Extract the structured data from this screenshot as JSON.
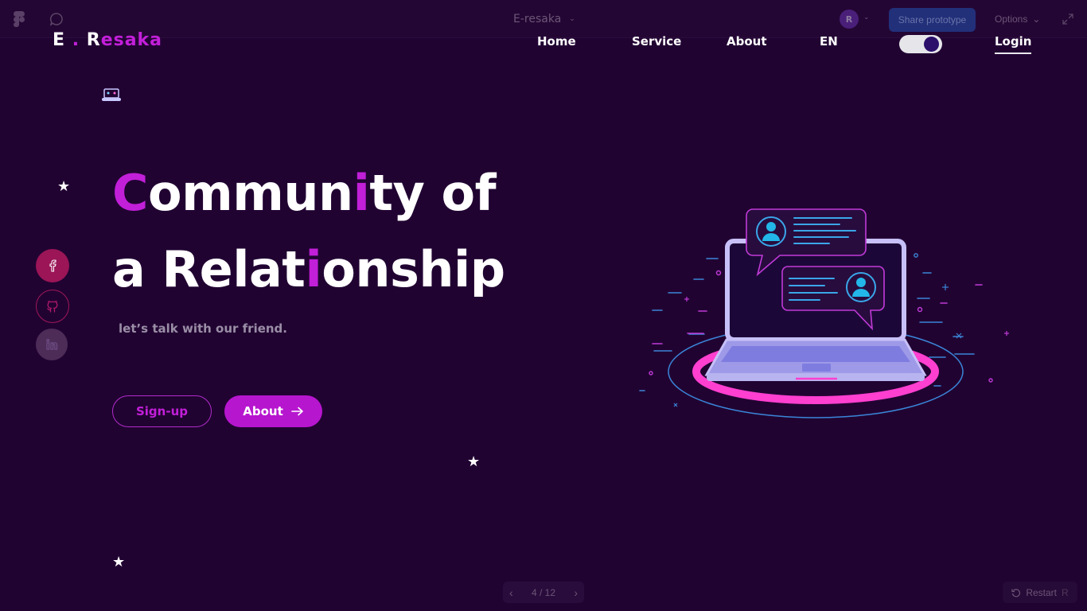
{
  "figma": {
    "file_title": "E-resaka",
    "user_initial": "R",
    "share_label": "Share prototype",
    "options_label": "Options",
    "pager_text": "4 / 12",
    "restart_label": "Restart",
    "restart_key": "R",
    "icons": [
      "figma-logo-icon",
      "comment-icon",
      "chevron-down-icon",
      "expand-icon",
      "chevron-left-icon",
      "chevron-right-icon",
      "restart-icon"
    ]
  },
  "site": {
    "logo": {
      "part1": "E",
      "dot": ".",
      "part2_first": "R",
      "part2_rest": "esaka"
    },
    "nav": {
      "home": "Home",
      "service": "Service",
      "about": "About",
      "lang": "EN",
      "login": "Login",
      "toggle_on": true
    },
    "hero": {
      "line1": {
        "c": "C",
        "a": "ommun",
        "i": "i",
        "b": "ty of"
      },
      "line2": {
        "a": "a Relat",
        "i": "i",
        "b": "onship"
      },
      "tagline": "let’s talk with our friend."
    },
    "buttons": {
      "signup": "Sign-up",
      "about": "About"
    },
    "social": [
      "facebook-icon",
      "github-icon",
      "linkedin-icon"
    ],
    "colors": {
      "background": "#210332",
      "accent": "#c21fd9",
      "button_fill": "#b716cf",
      "facebook": "#9b1557",
      "ring": "#ff3fd0",
      "laptop": "#b8b4f0"
    }
  }
}
